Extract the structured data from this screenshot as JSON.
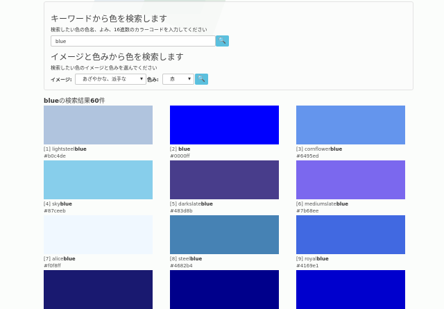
{
  "keyword_search": {
    "heading": "キーワードから色を検索します",
    "desc": "検索したい色の色名、よみ、16進数のカラーコードを入力してください",
    "value": "blue"
  },
  "image_search": {
    "heading": "イメージと色みから色を検索します",
    "desc": "検索したい色のイメージと色みを選んでください",
    "image_label": "イメージ:",
    "image_value": "あざやかな、派手な",
    "hue_label": "色み:",
    "hue_value": "赤"
  },
  "results": {
    "query": "blue",
    "middle": "の検索結果",
    "count": "60",
    "suffix": "件"
  },
  "colors": [
    {
      "n": "[1]",
      "pre": "lightsteel",
      "hl": "blue",
      "hex": "#b0c4de"
    },
    {
      "n": "[2]",
      "pre": "",
      "hl": "blue",
      "hex": "#0000ff"
    },
    {
      "n": "[3]",
      "pre": "cornflower",
      "hl": "blue",
      "hex": "#6495ed"
    },
    {
      "n": "[4]",
      "pre": "sky",
      "hl": "blue",
      "hex": "#87ceeb"
    },
    {
      "n": "[5]",
      "pre": "darkslate",
      "hl": "blue",
      "hex": "#483d8b"
    },
    {
      "n": "[6]",
      "pre": "mediumslate",
      "hl": "blue",
      "hex": "#7b68ee"
    },
    {
      "n": "[7]",
      "pre": "alice",
      "hl": "blue",
      "hex": "#f0f8ff"
    },
    {
      "n": "[8]",
      "pre": "steel",
      "hl": "blue",
      "hex": "#4682b4"
    },
    {
      "n": "[9]",
      "pre": "royal",
      "hl": "blue",
      "hex": "#4169e1"
    }
  ],
  "partial_swatches": [
    "#191970",
    "#00008b",
    "#0000cd"
  ]
}
